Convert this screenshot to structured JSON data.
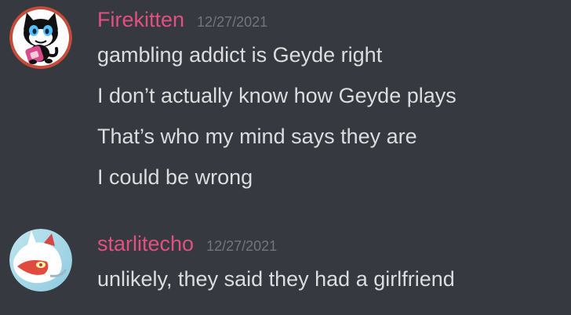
{
  "messages": [
    {
      "username": "Firekitten",
      "timestamp": "12/27/2021",
      "lines": [
        "gambling addict is Geyde right",
        "I don’t actually know how Geyde plays",
        "That’s who my mind says they are",
        "I could be wrong"
      ]
    },
    {
      "username": "starlitecho",
      "timestamp": "12/27/2021",
      "lines": [
        "unlikely, they said they had a girlfriend"
      ]
    }
  ],
  "colors": {
    "background": "#36393f",
    "username": "#e25080",
    "timestamp": "#72767d",
    "message_text": "#dcddde"
  }
}
